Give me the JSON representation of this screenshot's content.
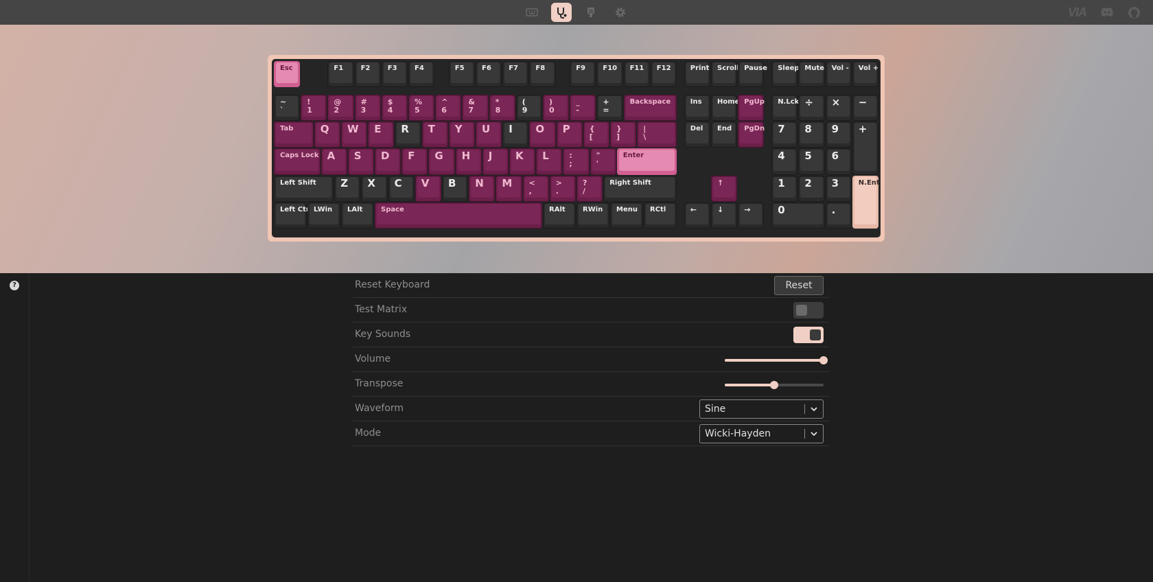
{
  "nav": {
    "icons": [
      "keyboard-icon",
      "stethoscope-icon",
      "badge-icon",
      "gear-icon"
    ],
    "active": "stethoscope-icon"
  },
  "header_right": {
    "logo_text": "VIA",
    "icons": [
      "discord-icon",
      "github-icon"
    ]
  },
  "colors": {
    "accent": "#f1cfc4",
    "magenta_key": "#7a2656",
    "dark_key": "#383838",
    "pink_key": "#e58ab0"
  },
  "keyboard": {
    "keys": [
      {
        "l": "Esc",
        "x": 0,
        "y": 0,
        "w": 1,
        "s": "pink",
        "f": "s"
      },
      {
        "l": "F1",
        "x": 2,
        "y": 0,
        "w": 1,
        "s": "dark",
        "f": "s"
      },
      {
        "l": "F2",
        "x": 3,
        "y": 0,
        "w": 1,
        "s": "dark",
        "f": "s"
      },
      {
        "l": "F3",
        "x": 4,
        "y": 0,
        "w": 1,
        "s": "dark",
        "f": "s"
      },
      {
        "l": "F4",
        "x": 5,
        "y": 0,
        "w": 1,
        "s": "dark",
        "f": "s"
      },
      {
        "l": "F5",
        "x": 6.5,
        "y": 0,
        "w": 1,
        "s": "dark",
        "f": "s"
      },
      {
        "l": "F6",
        "x": 7.5,
        "y": 0,
        "w": 1,
        "s": "dark",
        "f": "s"
      },
      {
        "l": "F7",
        "x": 8.5,
        "y": 0,
        "w": 1,
        "s": "dark",
        "f": "s"
      },
      {
        "l": "F8",
        "x": 9.5,
        "y": 0,
        "w": 1,
        "s": "dark",
        "f": "s"
      },
      {
        "l": "F9",
        "x": 11,
        "y": 0,
        "w": 1,
        "s": "dark",
        "f": "s"
      },
      {
        "l": "F10",
        "x": 12,
        "y": 0,
        "w": 1,
        "s": "dark",
        "f": "s"
      },
      {
        "l": "F11",
        "x": 13,
        "y": 0,
        "w": 1,
        "s": "dark",
        "f": "s"
      },
      {
        "l": "F12",
        "x": 14,
        "y": 0,
        "w": 1,
        "s": "dark",
        "f": "s"
      },
      {
        "l": "Print",
        "x": 15.25,
        "y": 0,
        "w": 1,
        "s": "dark",
        "f": "s"
      },
      {
        "l": "Scroll",
        "x": 16.25,
        "y": 0,
        "w": 1,
        "s": "dark",
        "f": "s"
      },
      {
        "l": "Pause",
        "x": 17.25,
        "y": 0,
        "w": 1,
        "s": "dark",
        "f": "s"
      },
      {
        "l": "Sleep",
        "x": 18.5,
        "y": 0,
        "w": 1,
        "s": "dark",
        "f": "s"
      },
      {
        "l": "Mute",
        "x": 19.5,
        "y": 0,
        "w": 1,
        "s": "dark",
        "f": "s"
      },
      {
        "l": "Vol -",
        "x": 20.5,
        "y": 0,
        "w": 1,
        "s": "dark",
        "f": "s"
      },
      {
        "l": "Vol +",
        "x": 21.5,
        "y": 0,
        "w": 1,
        "s": "dark",
        "f": "s"
      },
      {
        "l": "~\n`",
        "x": 0,
        "y": 1.25,
        "w": 1,
        "s": "dark",
        "f": "d"
      },
      {
        "l": "!\n1",
        "x": 1,
        "y": 1.25,
        "w": 1,
        "s": "mag",
        "f": "d"
      },
      {
        "l": "@\n2",
        "x": 2,
        "y": 1.25,
        "w": 1,
        "s": "mag",
        "f": "d"
      },
      {
        "l": "#\n3",
        "x": 3,
        "y": 1.25,
        "w": 1,
        "s": "mag",
        "f": "d"
      },
      {
        "l": "$\n4",
        "x": 4,
        "y": 1.25,
        "w": 1,
        "s": "mag",
        "f": "d"
      },
      {
        "l": "%\n5",
        "x": 5,
        "y": 1.25,
        "w": 1,
        "s": "mag",
        "f": "d"
      },
      {
        "l": "^\n6",
        "x": 6,
        "y": 1.25,
        "w": 1,
        "s": "mag",
        "f": "d"
      },
      {
        "l": "&\n7",
        "x": 7,
        "y": 1.25,
        "w": 1,
        "s": "mag",
        "f": "d"
      },
      {
        "l": "*\n8",
        "x": 8,
        "y": 1.25,
        "w": 1,
        "s": "mag",
        "f": "d"
      },
      {
        "l": "(\n9",
        "x": 9,
        "y": 1.25,
        "w": 1,
        "s": "dark",
        "f": "d"
      },
      {
        "l": ")\n0",
        "x": 10,
        "y": 1.25,
        "w": 1,
        "s": "mag",
        "f": "d"
      },
      {
        "l": "_\n-",
        "x": 11,
        "y": 1.25,
        "w": 1,
        "s": "mag",
        "f": "d"
      },
      {
        "l": "+\n=",
        "x": 12,
        "y": 1.25,
        "w": 1,
        "s": "dark",
        "f": "d"
      },
      {
        "l": "Backspace",
        "x": 13,
        "y": 1.25,
        "w": 2,
        "s": "mag",
        "f": "s"
      },
      {
        "l": "Ins",
        "x": 15.25,
        "y": 1.25,
        "w": 1,
        "s": "dark",
        "f": "s"
      },
      {
        "l": "Home",
        "x": 16.25,
        "y": 1.25,
        "w": 1,
        "s": "dark",
        "f": "s"
      },
      {
        "l": "PgUp",
        "x": 17.25,
        "y": 1.25,
        "w": 1,
        "s": "mag",
        "f": "s"
      },
      {
        "l": "N.Lck",
        "x": 18.5,
        "y": 1.25,
        "w": 1,
        "s": "dark",
        "f": "s"
      },
      {
        "l": "÷",
        "x": 19.5,
        "y": 1.25,
        "w": 1,
        "s": "dark",
        "f": "l"
      },
      {
        "l": "×",
        "x": 20.5,
        "y": 1.25,
        "w": 1,
        "s": "dark",
        "f": "l"
      },
      {
        "l": "−",
        "x": 21.5,
        "y": 1.25,
        "w": 1,
        "s": "dark",
        "f": "l"
      },
      {
        "l": "Tab",
        "x": 0,
        "y": 2.25,
        "w": 1.5,
        "s": "mag",
        "f": "s"
      },
      {
        "l": "Q",
        "x": 1.5,
        "y": 2.25,
        "w": 1,
        "s": "mag",
        "f": "l"
      },
      {
        "l": "W",
        "x": 2.5,
        "y": 2.25,
        "w": 1,
        "s": "mag",
        "f": "l"
      },
      {
        "l": "E",
        "x": 3.5,
        "y": 2.25,
        "w": 1,
        "s": "mag",
        "f": "l"
      },
      {
        "l": "R",
        "x": 4.5,
        "y": 2.25,
        "w": 1,
        "s": "dark",
        "f": "l"
      },
      {
        "l": "T",
        "x": 5.5,
        "y": 2.25,
        "w": 1,
        "s": "mag",
        "f": "l"
      },
      {
        "l": "Y",
        "x": 6.5,
        "y": 2.25,
        "w": 1,
        "s": "mag",
        "f": "l"
      },
      {
        "l": "U",
        "x": 7.5,
        "y": 2.25,
        "w": 1,
        "s": "mag",
        "f": "l"
      },
      {
        "l": "I",
        "x": 8.5,
        "y": 2.25,
        "w": 1,
        "s": "dark",
        "f": "l"
      },
      {
        "l": "O",
        "x": 9.5,
        "y": 2.25,
        "w": 1,
        "s": "mag",
        "f": "l"
      },
      {
        "l": "P",
        "x": 10.5,
        "y": 2.25,
        "w": 1,
        "s": "mag",
        "f": "l"
      },
      {
        "l": "{\n[",
        "x": 11.5,
        "y": 2.25,
        "w": 1,
        "s": "mag",
        "f": "d"
      },
      {
        "l": "}\n]",
        "x": 12.5,
        "y": 2.25,
        "w": 1,
        "s": "mag",
        "f": "d"
      },
      {
        "l": "|\n\\",
        "x": 13.5,
        "y": 2.25,
        "w": 1.5,
        "s": "mag",
        "f": "d"
      },
      {
        "l": "Del",
        "x": 15.25,
        "y": 2.25,
        "w": 1,
        "s": "dark",
        "f": "s"
      },
      {
        "l": "End",
        "x": 16.25,
        "y": 2.25,
        "w": 1,
        "s": "dark",
        "f": "s"
      },
      {
        "l": "PgDn",
        "x": 17.25,
        "y": 2.25,
        "w": 1,
        "s": "mag",
        "f": "s"
      },
      {
        "l": "7",
        "x": 18.5,
        "y": 2.25,
        "w": 1,
        "s": "dark",
        "f": "l"
      },
      {
        "l": "8",
        "x": 19.5,
        "y": 2.25,
        "w": 1,
        "s": "dark",
        "f": "l"
      },
      {
        "l": "9",
        "x": 20.5,
        "y": 2.25,
        "w": 1,
        "s": "dark",
        "f": "l"
      },
      {
        "l": "+",
        "x": 21.5,
        "y": 2.25,
        "w": 1,
        "h": 2,
        "s": "dark",
        "f": "l"
      },
      {
        "l": "Caps Lock",
        "x": 0,
        "y": 3.25,
        "w": 1.75,
        "s": "mag",
        "f": "s"
      },
      {
        "l": "A",
        "x": 1.75,
        "y": 3.25,
        "w": 1,
        "s": "mag",
        "f": "l"
      },
      {
        "l": "S",
        "x": 2.75,
        "y": 3.25,
        "w": 1,
        "s": "mag",
        "f": "l"
      },
      {
        "l": "D",
        "x": 3.75,
        "y": 3.25,
        "w": 1,
        "s": "mag",
        "f": "l"
      },
      {
        "l": "F",
        "x": 4.75,
        "y": 3.25,
        "w": 1,
        "s": "mag",
        "f": "l"
      },
      {
        "l": "G",
        "x": 5.75,
        "y": 3.25,
        "w": 1,
        "s": "mag",
        "f": "l"
      },
      {
        "l": "H",
        "x": 6.75,
        "y": 3.25,
        "w": 1,
        "s": "mag",
        "f": "l"
      },
      {
        "l": "J",
        "x": 7.75,
        "y": 3.25,
        "w": 1,
        "s": "mag",
        "f": "l"
      },
      {
        "l": "K",
        "x": 8.75,
        "y": 3.25,
        "w": 1,
        "s": "mag",
        "f": "l"
      },
      {
        "l": "L",
        "x": 9.75,
        "y": 3.25,
        "w": 1,
        "s": "mag",
        "f": "l"
      },
      {
        "l": ":\n;",
        "x": 10.75,
        "y": 3.25,
        "w": 1,
        "s": "mag",
        "f": "d"
      },
      {
        "l": "\"\n'",
        "x": 11.75,
        "y": 3.25,
        "w": 1,
        "s": "mag",
        "f": "d"
      },
      {
        "l": "Enter",
        "x": 12.75,
        "y": 3.25,
        "w": 2.25,
        "s": "pink",
        "f": "s"
      },
      {
        "l": "4",
        "x": 18.5,
        "y": 3.25,
        "w": 1,
        "s": "dark",
        "f": "l"
      },
      {
        "l": "5",
        "x": 19.5,
        "y": 3.25,
        "w": 1,
        "s": "dark",
        "f": "l"
      },
      {
        "l": "6",
        "x": 20.5,
        "y": 3.25,
        "w": 1,
        "s": "dark",
        "f": "l"
      },
      {
        "l": "Left Shift",
        "x": 0,
        "y": 4.25,
        "w": 2.25,
        "s": "dark",
        "f": "s"
      },
      {
        "l": "Z",
        "x": 2.25,
        "y": 4.25,
        "w": 1,
        "s": "dark",
        "f": "l"
      },
      {
        "l": "X",
        "x": 3.25,
        "y": 4.25,
        "w": 1,
        "s": "dark",
        "f": "l"
      },
      {
        "l": "C",
        "x": 4.25,
        "y": 4.25,
        "w": 1,
        "s": "dark",
        "f": "l"
      },
      {
        "l": "V",
        "x": 5.25,
        "y": 4.25,
        "w": 1,
        "s": "mag",
        "f": "l"
      },
      {
        "l": "B",
        "x": 6.25,
        "y": 4.25,
        "w": 1,
        "s": "dark",
        "f": "l"
      },
      {
        "l": "N",
        "x": 7.25,
        "y": 4.25,
        "w": 1,
        "s": "mag",
        "f": "l"
      },
      {
        "l": "M",
        "x": 8.25,
        "y": 4.25,
        "w": 1,
        "s": "mag",
        "f": "l"
      },
      {
        "l": "<\n,",
        "x": 9.25,
        "y": 4.25,
        "w": 1,
        "s": "mag",
        "f": "d"
      },
      {
        "l": ">\n.",
        "x": 10.25,
        "y": 4.25,
        "w": 1,
        "s": "mag",
        "f": "d"
      },
      {
        "l": "?\n/",
        "x": 11.25,
        "y": 4.25,
        "w": 1,
        "s": "mag",
        "f": "d"
      },
      {
        "l": "Right Shift",
        "x": 12.25,
        "y": 4.25,
        "w": 2.75,
        "s": "dark",
        "f": "s"
      },
      {
        "l": "↑",
        "x": 16.25,
        "y": 4.25,
        "w": 1,
        "s": "mag",
        "f": "m"
      },
      {
        "l": "1",
        "x": 18.5,
        "y": 4.25,
        "w": 1,
        "s": "dark",
        "f": "l"
      },
      {
        "l": "2",
        "x": 19.5,
        "y": 4.25,
        "w": 1,
        "s": "dark",
        "f": "l"
      },
      {
        "l": "3",
        "x": 20.5,
        "y": 4.25,
        "w": 1,
        "s": "dark",
        "f": "l"
      },
      {
        "l": "N.Ent",
        "x": 21.5,
        "y": 4.25,
        "w": 1,
        "h": 2,
        "s": "peach",
        "f": "s"
      },
      {
        "l": "Left Ctrl",
        "x": 0,
        "y": 5.25,
        "w": 1.25,
        "s": "dark",
        "f": "s"
      },
      {
        "l": "LWin",
        "x": 1.25,
        "y": 5.25,
        "w": 1.25,
        "s": "dark",
        "f": "s"
      },
      {
        "l": "LAlt",
        "x": 2.5,
        "y": 5.25,
        "w": 1.25,
        "s": "dark",
        "f": "s"
      },
      {
        "l": "Space",
        "x": 3.75,
        "y": 5.25,
        "w": 6.25,
        "s": "mag",
        "f": "s"
      },
      {
        "l": "RAlt",
        "x": 10,
        "y": 5.25,
        "w": 1.25,
        "s": "dark",
        "f": "s"
      },
      {
        "l": "RWin",
        "x": 11.25,
        "y": 5.25,
        "w": 1.25,
        "s": "dark",
        "f": "s"
      },
      {
        "l": "Menu",
        "x": 12.5,
        "y": 5.25,
        "w": 1.25,
        "s": "dark",
        "f": "s"
      },
      {
        "l": "RCtl",
        "x": 13.75,
        "y": 5.25,
        "w": 1.25,
        "s": "dark",
        "f": "s"
      },
      {
        "l": "←",
        "x": 15.25,
        "y": 5.25,
        "w": 1,
        "s": "dark",
        "f": "m"
      },
      {
        "l": "↓",
        "x": 16.25,
        "y": 5.25,
        "w": 1,
        "s": "dark",
        "f": "m"
      },
      {
        "l": "→",
        "x": 17.25,
        "y": 5.25,
        "w": 1,
        "s": "dark",
        "f": "m"
      },
      {
        "l": "0",
        "x": 18.5,
        "y": 5.25,
        "w": 2,
        "s": "dark",
        "f": "l"
      },
      {
        "l": ".",
        "x": 20.5,
        "y": 5.25,
        "w": 1,
        "s": "dark",
        "f": "l"
      }
    ]
  },
  "help_icon": "?",
  "settings": {
    "reset_label": "Reset Keyboard",
    "reset_button": "Reset",
    "test_matrix_label": "Test Matrix",
    "test_matrix_on": false,
    "key_sounds_label": "Key Sounds",
    "key_sounds_on": true,
    "volume_label": "Volume",
    "volume_value": 1.0,
    "transpose_label": "Transpose",
    "transpose_value": 0.5,
    "waveform_label": "Waveform",
    "waveform_value": "Sine",
    "mode_label": "Mode",
    "mode_value": "Wicki-Hayden"
  }
}
